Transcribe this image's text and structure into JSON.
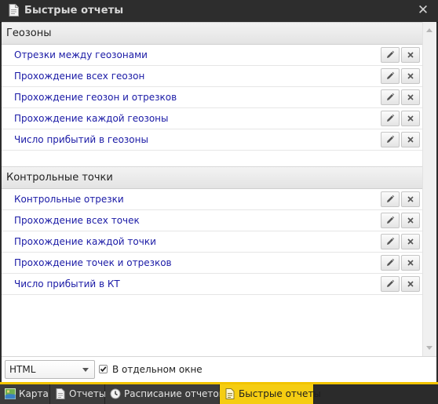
{
  "window": {
    "title": "Быстрые отчеты",
    "title_icon": "document-icon",
    "close_icon": "close-icon"
  },
  "groups": [
    {
      "label": "Геозоны",
      "items": [
        {
          "label": "Отрезки между геозонами"
        },
        {
          "label": "Прохождение всех геозон"
        },
        {
          "label": "Прохождение геозон и отрезков"
        },
        {
          "label": "Прохождение каждой геозоны"
        },
        {
          "label": "Число прибытий в геозоны"
        }
      ]
    },
    {
      "label": "Контрольные точки",
      "items": [
        {
          "label": "Контрольные отрезки"
        },
        {
          "label": "Прохождение всех точек"
        },
        {
          "label": "Прохождение каждой точки"
        },
        {
          "label": "Прохождение точек и отрезков"
        },
        {
          "label": "Число прибытий в КТ"
        }
      ]
    }
  ],
  "row_actions": {
    "edit_icon": "pencil-icon",
    "delete_icon": "close-icon"
  },
  "bottom": {
    "format_select": {
      "value": "HTML"
    },
    "separate_window": {
      "label": "В отдельном окне",
      "checked": true
    }
  },
  "taskbar": {
    "tabs": [
      {
        "label": "Карта",
        "icon": "map-icon",
        "active": false
      },
      {
        "label": "Отчеты",
        "icon": "document-icon",
        "active": false
      },
      {
        "label": "Расписание отчетов",
        "icon": "clock-icon",
        "active": false
      },
      {
        "label": "Быстрые отчеты",
        "icon": "document-icon",
        "active": true
      }
    ]
  },
  "colors": {
    "accent": "#f5cd12",
    "link": "#1a1aa6",
    "titlebar": "#2d2d2d"
  }
}
